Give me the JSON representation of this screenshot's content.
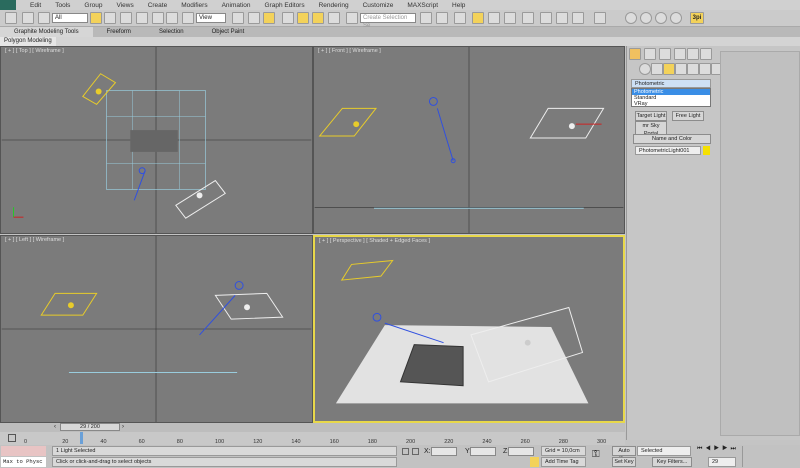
{
  "menu": [
    "Edit",
    "Tools",
    "Group",
    "Views",
    "Create",
    "Modifiers",
    "Animation",
    "Graph Editors",
    "Rendering",
    "Customize",
    "MAXScript",
    "Help"
  ],
  "toolbar": {
    "selection_filter": "All",
    "ref_coord": "View",
    "named_selection_placeholder": "Create Selection Se",
    "badge": "3pi"
  },
  "ribbon": {
    "tabs": [
      "Graphite Modeling Tools",
      "Freeform",
      "Selection",
      "Object Paint"
    ],
    "sub_tab": "Polygon Modeling"
  },
  "viewports": [
    {
      "label": "[ + ] [ Top ] [ Wireframe ]"
    },
    {
      "label": "[ + ] [ Front ] [ Wireframe ]"
    },
    {
      "label": "[ + ] [ Left ] [ Wireframe ]"
    },
    {
      "label": "[ + ] [ Perspective ] [ Shaded + Edged Faces ]"
    }
  ],
  "command_panel": {
    "dropdown_value": "Photometric",
    "dropdown_options": [
      "Photometric",
      "Standard",
      "VRay"
    ],
    "buttons": [
      "Target Light",
      "Free Light",
      "mr Sky Portal"
    ],
    "rollout": "Name and Color",
    "object_name": "PhotometricLight001",
    "object_color": "#f5e000"
  },
  "timeline": {
    "frame": "29 / 200",
    "current": 29,
    "total": 200,
    "ticks": [
      "0",
      "20",
      "40",
      "60",
      "80",
      "100",
      "120",
      "140",
      "160",
      "180",
      "200",
      "220",
      "240",
      "260",
      "280",
      "300"
    ]
  },
  "status": {
    "script_listener": "Max to Physc",
    "selection": "1 Light Selected",
    "prompt": "Click or click-and-drag to select objects",
    "x_label": "X:",
    "y_label": "Y:",
    "z_label": "Z:",
    "grid": "Grid = 10,0cm",
    "add_time_tag": "Add Time Tag",
    "auto_key": "Auto Key",
    "set_key": "Set Key",
    "key_mode": "Selected",
    "key_filters": "Key Filters...",
    "frame_field": "29"
  }
}
